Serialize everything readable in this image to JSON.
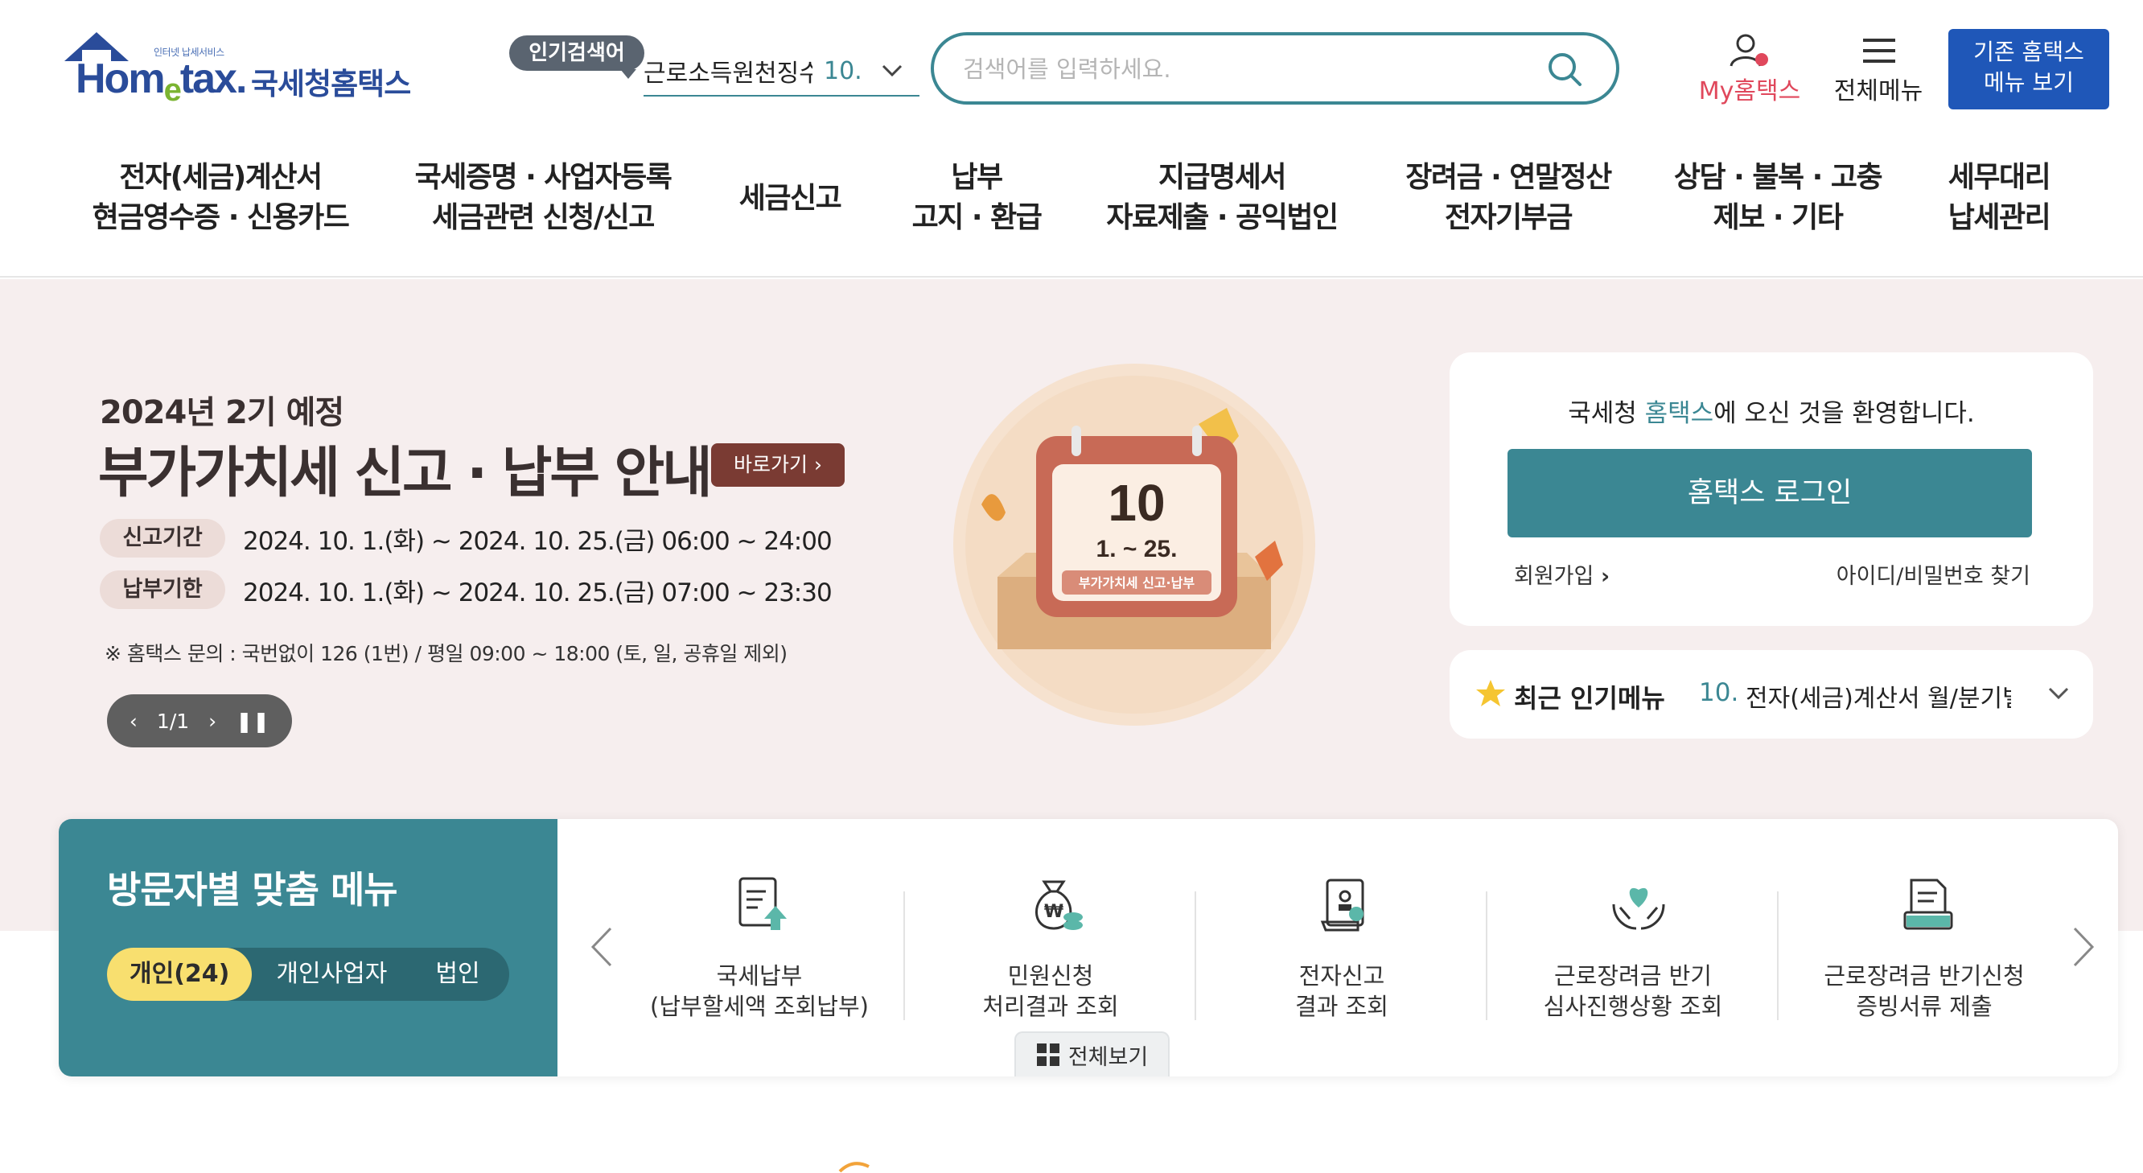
{
  "header": {
    "logo_sub": "인터넷 납세서비스",
    "logo_brand_pre": "Hom",
    "logo_brand_e": "e",
    "logo_brand_post": "tax.",
    "logo_kr": "국세청홈택스",
    "popular_badge": "인기검색어",
    "popular_keyword": "근로소득원천징수영수증",
    "popular_rank": "10.",
    "search_placeholder": "검색어를 입력하세요.",
    "my_hometax": "My홈택스",
    "all_menu": "전체메뉴",
    "old_menu_line1": "기존 홈택스",
    "old_menu_line2": "메뉴 보기"
  },
  "gnb": [
    {
      "line1": "전자(세금)계산서",
      "line2": "현금영수증 · 신용카드"
    },
    {
      "line1": "국세증명 · 사업자등록",
      "line2": "세금관련 신청/신고"
    },
    {
      "line1": "세금신고",
      "line2": ""
    },
    {
      "line1": "납부",
      "line2": "고지 · 환급"
    },
    {
      "line1": "지급명세서",
      "line2": "자료제출 · 공익법인"
    },
    {
      "line1": "장려금 · 연말정산",
      "line2": "전자기부금"
    },
    {
      "line1": "상담 · 불복 · 고충",
      "line2": "제보 · 기타"
    },
    {
      "line1": "세무대리",
      "line2": "납세관리"
    }
  ],
  "hero": {
    "small_title": "2024년 2기 예정",
    "big_title": "부가가치세 신고 · 납부 안내",
    "go_button": "바로가기",
    "rows": [
      {
        "label": "신고기간",
        "value": "2024. 10. 1.(화) ~ 2024. 10. 25.(금) 06:00 ~ 24:00"
      },
      {
        "label": "납부기한",
        "value": "2024. 10. 1.(화) ~ 2024. 10. 25.(금) 07:00 ~ 23:30"
      }
    ],
    "note": "※ 홈택스 문의 : 국번없이 126 (1번) / 평일 09:00 ~ 18:00 (토, 일, 공휴일 제외)",
    "pager": "1/1",
    "calendar_number": "10",
    "calendar_range": "1. ~ 25.",
    "calendar_caption": "부가가치세 신고·납부"
  },
  "login": {
    "welcome_pre": "국세청 ",
    "welcome_hl": "홈택스",
    "welcome_post": "에 오신 것을 환영합니다.",
    "login_button": "홈택스 로그인",
    "join": "회원가입",
    "find": "아이디/비밀번호 찾기"
  },
  "popular_menu": {
    "title": "최근 인기메뉴",
    "rank": "10.",
    "value": "전자(세금)계산서 월/분기별 통계조회"
  },
  "visitor": {
    "title": "방문자별 맞춤 메뉴",
    "tabs": [
      "개인(24)",
      "개인사업자",
      "법인"
    ],
    "services": [
      {
        "l1": "국세납부",
        "l2": "(납부할세액 조회납부)"
      },
      {
        "l1": "민원신청",
        "l2": "처리결과 조회"
      },
      {
        "l1": "전자신고",
        "l2": "결과 조회"
      },
      {
        "l1": "근로장려금 반기",
        "l2": "심사진행상황 조회"
      },
      {
        "l1": "근로장려금 반기신청",
        "l2": "증빙서류 제출"
      }
    ],
    "view_all": "전체보기"
  },
  "colors": {
    "primary_teal": "#3b8793",
    "brand_blue": "#1f57b8",
    "hero_bg": "#f6eeee",
    "accent_yellow": "#f8df6f",
    "my_red": "#e0485c"
  }
}
